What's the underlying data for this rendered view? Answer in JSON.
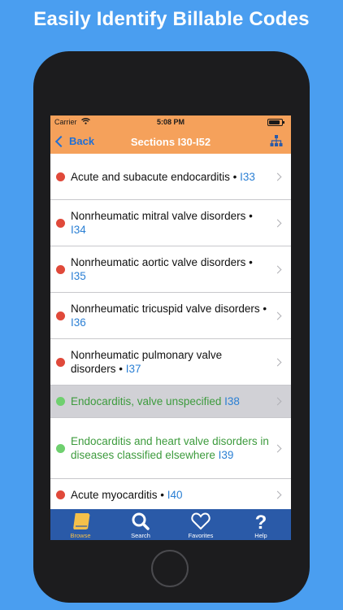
{
  "headline": "Easily Identify Billable Codes",
  "status_bar": {
    "carrier": "Carrier",
    "time": "5:08 PM"
  },
  "nav": {
    "back_label": "Back",
    "title": "Sections I30-I52"
  },
  "colors": {
    "header": "#f5a15b",
    "nonbillable_dot": "#e0493a",
    "billable_dot": "#6fd06f",
    "code_link": "#2a7fd4",
    "tab_bar": "#2a5aa8",
    "tab_active": "#f5c04a"
  },
  "rows": [
    {
      "title": "Acute and subacute endocarditis",
      "sep": " • ",
      "code": "I33"
    },
    {
      "title": "Nonrheumatic mitral valve disorders",
      "sep": " • ",
      "code": "I34"
    },
    {
      "title": "Nonrheumatic aortic valve disorders",
      "sep": " • ",
      "code": "I35"
    },
    {
      "title": "Nonrheumatic tricuspid valve disorders",
      "sep": " • ",
      "code": "I36"
    },
    {
      "title": "Nonrheumatic pulmonary valve disorders",
      "sep": " • ",
      "code": "I37"
    },
    {
      "title": "Endocarditis, valve unspecified",
      "sep": " ",
      "code": "I38"
    },
    {
      "title": "Endocarditis and heart valve disorders in diseases classified elsewhere",
      "sep": " ",
      "code": "I39"
    },
    {
      "title": "Acute myocarditis",
      "sep": " • ",
      "code": "I40"
    }
  ],
  "tabs": [
    {
      "label": "Browse",
      "icon": "book-icon"
    },
    {
      "label": "Search",
      "icon": "search-icon"
    },
    {
      "label": "Favorites",
      "icon": "heart-icon"
    },
    {
      "label": "Help",
      "icon": "question-icon"
    }
  ]
}
